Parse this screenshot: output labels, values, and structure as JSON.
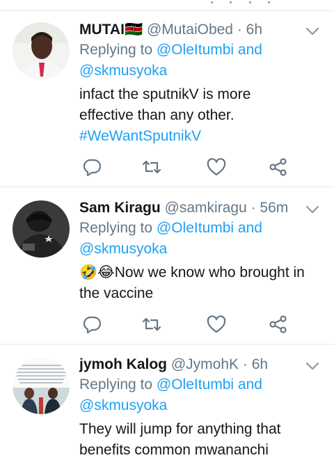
{
  "tweets": [
    {
      "name": "MUTAI",
      "flag": "🇰🇪",
      "handle": "@MutaiObed",
      "separator": "·",
      "time": "6h",
      "replying_label": "Replying to",
      "replying_mentions": "@OleItumbi and @skmusyoka",
      "text_lines": [
        "infact the sputnikV is more",
        "effective than any other."
      ],
      "hashtag": "#WeWantSputnikV"
    },
    {
      "name": "Sam Kiragu",
      "handle": "@samkiragu",
      "separator": "·",
      "time": "56m",
      "replying_label": "Replying to",
      "replying_mentions": "@OleItumbi and @skmusyoka",
      "emoji": "🤣😂",
      "text_lines": [
        "Now we know who brought in",
        "the vaccine"
      ]
    },
    {
      "name": "jymoh Kalog",
      "handle": "@JymohK",
      "separator": "·",
      "time": "6h",
      "replying_label": "Replying to",
      "replying_mentions": "@OleItumbi and @skmusyoka",
      "text_lines": [
        "They will jump for anything that",
        "benefits common mwananchi"
      ]
    }
  ],
  "colors": {
    "link": "#1da1f2",
    "secondary_text": "#657786",
    "divider": "#e1e8ed",
    "action_icon": "#657786"
  },
  "icons": [
    "reply-icon",
    "retweet-icon",
    "like-icon",
    "share-icon",
    "chevron-down-icon"
  ]
}
